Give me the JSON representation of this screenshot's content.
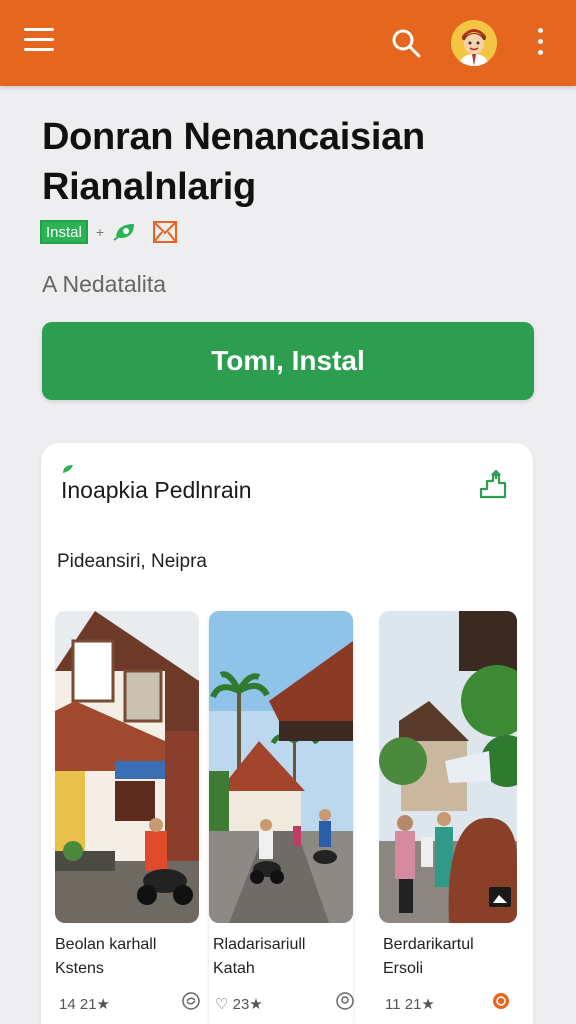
{
  "appbar": {
    "menu_icon": "hamburger-menu-icon",
    "search_icon": "search-icon",
    "avatar_icon": "user-avatar",
    "more_icon": "more-vertical-icon",
    "color": "#e4661f"
  },
  "app": {
    "title_line1": "Donran Nenancaisian",
    "title_line2": "Rianalnlarig",
    "badge_install": "Instal",
    "badge_sep": "+",
    "subtitle": "A Nedatalita"
  },
  "install_button": {
    "label": "Tomı, Instal",
    "color": "#2d9d50"
  },
  "card": {
    "title": "Inoapkia Pedlnrain",
    "subtitle": "Pideansiri, Neipra",
    "tiles": [
      {
        "tag": "",
        "caption_line1": "Beolan karhall",
        "caption_line2": "Kstens",
        "meta": "14 21★",
        "meta_icon": "sync-icon"
      },
      {
        "tag": "",
        "caption_line1": "Rladarisariull",
        "caption_line2": "Katah",
        "meta": "♡ 23★",
        "meta_icon": "location-icon"
      },
      {
        "tag": "",
        "caption_line1": "Berdarikartul",
        "caption_line2": "Ersoli",
        "meta": "11 21★",
        "meta_icon": "record-icon"
      }
    ]
  }
}
